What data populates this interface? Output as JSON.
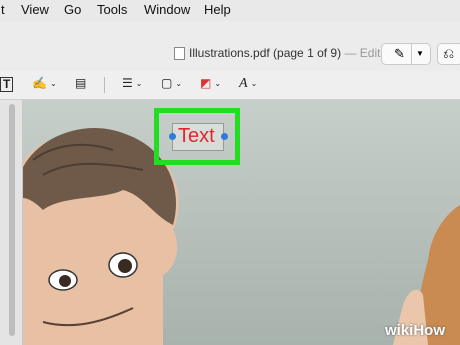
{
  "menubar": {
    "items": [
      "t",
      "View",
      "Go",
      "Tools",
      "Window",
      "Help"
    ]
  },
  "window": {
    "doc_title": "Illustrations.pdf (page 1 of 9)",
    "doc_status": "— Edited"
  },
  "toolbar": {
    "tools": [
      {
        "name": "text-tool",
        "icon": "text-box-icon",
        "glyph": "T"
      },
      {
        "name": "sign-tool",
        "icon": "signature-icon",
        "glyph": "✍"
      },
      {
        "name": "note-tool",
        "icon": "note-icon",
        "glyph": "▤"
      },
      {
        "name": "shape-style-tool",
        "icon": "line-style-icon",
        "glyph": "☰"
      },
      {
        "name": "border-color-tool",
        "icon": "border-color-icon",
        "glyph": "▢"
      },
      {
        "name": "fill-color-tool",
        "icon": "fill-color-icon",
        "glyph": "◩"
      },
      {
        "name": "text-style-tool",
        "icon": "text-style-icon",
        "glyph": "A"
      }
    ]
  },
  "annotation": {
    "text": "Text",
    "text_color": "#e0272b",
    "highlight_color": "#22dd22"
  },
  "watermark": {
    "text": "wikiHow"
  }
}
